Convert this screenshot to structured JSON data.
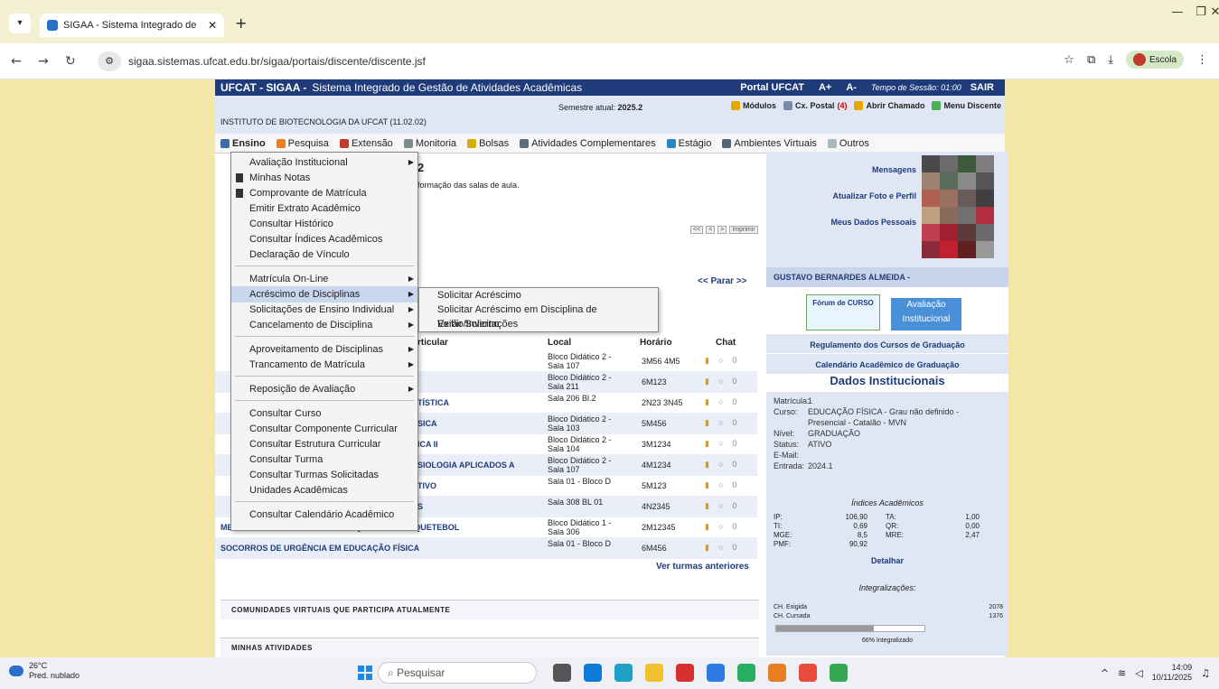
{
  "browser": {
    "tab_title": "SIGAA - Sistema Integrado de",
    "url": "sigaa.sistemas.ufcat.edu.br/sigaa/portais/discente/discente.jsf",
    "profile": "Escola"
  },
  "header": {
    "brand": "UFCAT - SIGAA -",
    "system_name": "Sistema Integrado de Gestão de Atividades Acadêmicas",
    "portal": "Portal UFCAT",
    "font_up": "A+",
    "font_down": "A-",
    "session": "Tempo de Sessão: 01:00",
    "logout": "SAIR"
  },
  "subheader": {
    "institution": "INSTITUTO DE BIOTECNOLOGIA DA UFCAT (11.02.02)",
    "semester_label": "Semestre atual:",
    "semester": "2025.2",
    "modules": "Módulos",
    "postal": "Cx. Postal",
    "postal_count": "(4)",
    "ticket": "Abrir Chamado",
    "menu": "Menu Discente"
  },
  "menubar": [
    "Ensino",
    "Pesquisa",
    "Extensão",
    "Monitoria",
    "Bolsas",
    "Atividades Complementares",
    "Estágio",
    "Ambientes Virtuais",
    "Outros"
  ],
  "dropdown": {
    "groups": [
      [
        "Avaliação Institucional",
        "Minhas Notas",
        "Comprovante de Matrícula",
        "Emitir Extrato Acadêmico",
        "Consultar Histórico",
        "Consultar Índices Acadêmicos",
        "Declaração de Vínculo"
      ],
      [
        "Matrícula On-Line",
        "Acréscimo de Disciplinas",
        "Solicitações de Ensino Individual",
        "Cancelamento de Disciplina"
      ],
      [
        "Aproveitamento de Disciplinas",
        "Trancamento de Matrícula"
      ],
      [
        "Reposição de Avaliação"
      ],
      [
        "Consultar Curso",
        "Consultar Componente Curricular",
        "Consultar Estrutura Curricular",
        "Consultar Turma",
        "Consultar Turmas Solicitadas",
        "Unidades Acadêmicas"
      ],
      [
        "Consultar Calendário Acadêmico"
      ]
    ],
    "submenu": [
      "Solicitar Acréscimo",
      "Solicitar Acréscimo em Disciplina de Verão/Inverno",
      "Exibir Solicitações"
    ]
  },
  "main": {
    "topic_num": "2",
    "topic_desc": "formação das salas de aula.",
    "pager": [
      "<<",
      "<",
      ">",
      "Imprimir"
    ],
    "parar": "<< Parar >>",
    "col_local": "Local",
    "col_horario": "Horário",
    "col_chat": "Chat",
    "col_disc": "rticular",
    "rows": [
      {
        "disc": "",
        "local": "Bloco Didático 2 - Sala 107",
        "horario": "3M56 4M5",
        "chat": "0"
      },
      {
        "disc": "",
        "local": "Bloco Didático 2 - Sala 211",
        "horario": "6M123",
        "chat": "0"
      },
      {
        "disc": "TÍSTICA",
        "local": "Sala 206 Bl.2",
        "horario": "2N23 3N45",
        "chat": "0"
      },
      {
        "disc": "SICA",
        "local": "Bloco Didático 2 - Sala 103",
        "horario": "5M456",
        "chat": "0"
      },
      {
        "disc": "ICA II",
        "local": "Bloco Didático 2 - Sala 104",
        "horario": "3M1234",
        "chat": "0"
      },
      {
        "disc": "SIOLOGIA APLICADOS A",
        "local": "Bloco Didático 2 - Sala 107",
        "horario": "4M1234",
        "chat": "0"
      },
      {
        "disc": "TIVO",
        "local": "Sala 01 - Bloco D",
        "horario": "5M123",
        "chat": "0"
      },
      {
        "disc": "S",
        "local": "Sala 308 BL 01",
        "horario": "4N2345",
        "chat": "0"
      },
      {
        "disc": "METODOLOGIA DE ENSINO E PESQUISA EM BASQUETEBOL",
        "local": "Bloco Didático 1 - Sala 306",
        "horario": "2M12345",
        "chat": "0"
      },
      {
        "disc": "SOCORROS DE URGÊNCIA EM EDUCAÇÃO FÍSICA",
        "local": "Sala 01 - Bloco D",
        "horario": "6M456",
        "chat": "0"
      }
    ],
    "ver_anteriores": "Ver turmas anteriores",
    "comunidades": "COMUNIDADES VIRTUAIS QUE PARTICIPA ATUALMENTE",
    "atividades": "MINHAS ATIVIDADES"
  },
  "sidebar": {
    "links": [
      "Mensagens",
      "Atualizar Foto e Perfil",
      "Meus Dados Pessoais"
    ],
    "student_name": "GUSTAVO BERNARDES ALMEIDA -",
    "forum": "Fórum de CURSO",
    "avaliacao": "Avaliação Institucional",
    "regulamento": "Regulamento dos Cursos de Graduação",
    "calendario": "Calendário Acadêmico de Graduação",
    "dados_title": "Dados Institucionais",
    "info": [
      {
        "label": "Matrícula:",
        "value": "1"
      },
      {
        "label": "Curso:",
        "value": "EDUCAÇÃO FÍSICA - Grau não definido - Presencial - Catalão - MVN"
      },
      {
        "label": "Nível:",
        "value": "GRADUAÇÃO"
      },
      {
        "label": "Status:",
        "value": "ATIVO"
      },
      {
        "label": "E-Mail:",
        "value": ""
      },
      {
        "label": "Entrada:",
        "value": "2024.1"
      }
    ],
    "indices_title": "Índices Acadêmicos",
    "indices": [
      {
        "a": "IP:",
        "av": "106,90",
        "b": "TA:",
        "bv": "1,00"
      },
      {
        "a": "TI:",
        "av": "0,69",
        "b": "QR:",
        "bv": "0,00"
      },
      {
        "a": "MGE:",
        "av": "8,5",
        "b": "MRE:",
        "bv": "2,47"
      },
      {
        "a": "PMF:",
        "av": "90,92",
        "b": "",
        "bv": ""
      }
    ],
    "detalhar": "Detalhar",
    "integ_title": "Integralizações:",
    "ch_exigida_label": "CH. Exigida",
    "ch_exigida": "2078",
    "ch_cursada_label": "CH. Cursada",
    "ch_cursada": "1376",
    "progress": 0.66,
    "progress_label": "66% Integralizado"
  },
  "taskbar": {
    "temp": "26°C",
    "weather": "Pred. nublado",
    "search": "Pesquisar",
    "time": "14:09",
    "date": "10/11/2025"
  }
}
